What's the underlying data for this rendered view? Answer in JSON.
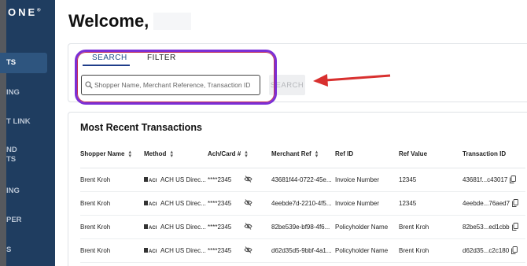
{
  "sidebar": {
    "logo": "ONE",
    "logo_mark": "®",
    "items": [
      {
        "label": "TS",
        "active": true
      },
      {
        "label": "ING"
      },
      {
        "label": "T LINK"
      },
      {
        "label": "ND",
        "label2": "TS"
      },
      {
        "label": "ING"
      },
      {
        "label": "PER"
      },
      {
        "label": "S"
      }
    ]
  },
  "header": {
    "welcome": "Welcome,"
  },
  "search": {
    "tabs": [
      "SEARCH",
      "FILTER"
    ],
    "active_tab": "SEARCH",
    "placeholder": "Shopper Name, Merchant Reference, Transaction ID",
    "button_label": "SEARCH"
  },
  "annotation": {
    "highlight_color": "#7b2fd6",
    "arrow_color": "#d8302f"
  },
  "transactions": {
    "title": "Most Recent Transactions",
    "columns": [
      "Shopper Name",
      "Method",
      "Ach/Card #",
      "Merchant Ref",
      "Ref ID",
      "Ref Value",
      "Transaction ID"
    ],
    "rows": [
      {
        "shopper": "Brent Kroh",
        "method": "ACH US Direc...",
        "card": "****2345",
        "merchant_ref": "43681f44-0722-45e...",
        "ref_id": "Invoice Number",
        "ref_value": "12345",
        "transaction_id": "43681f...c43017"
      },
      {
        "shopper": "Brent Kroh",
        "method": "ACH US Direc...",
        "card": "****2345",
        "merchant_ref": "4eebde7d-2210-4f5...",
        "ref_id": "Invoice Number",
        "ref_value": "12345",
        "transaction_id": "4eebde...76aed7"
      },
      {
        "shopper": "Brent Kroh",
        "method": "ACH US Direc...",
        "card": "****2345",
        "merchant_ref": "82be539e-bf98-4f6...",
        "ref_id": "Policyholder Name",
        "ref_value": "Brent Kroh",
        "transaction_id": "82be53...ed1cbb"
      },
      {
        "shopper": "Brent Kroh",
        "method": "ACH US Direc...",
        "card": "****2345",
        "merchant_ref": "d62d35d5-9bbf-4a1...",
        "ref_id": "Policyholder Name",
        "ref_value": "Brent Kroh",
        "transaction_id": "d62d35...c2c180"
      }
    ]
  },
  "colors": {
    "sidebar_bg": "#1f3d60",
    "accent": "#1f4f8a",
    "search_disabled": "#eeeff1"
  },
  "icons": {
    "method": "ach-bank-icon",
    "mask": "eye-slash-icon",
    "copy": "copy-icon",
    "search": "search-icon"
  }
}
